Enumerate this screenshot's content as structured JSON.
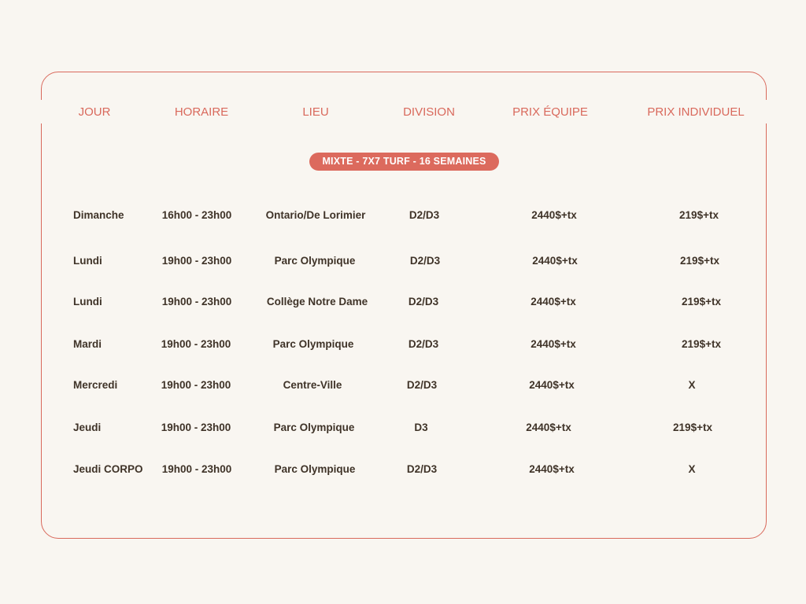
{
  "headers": [
    "JOUR",
    "HORAIRE",
    "LIEU",
    "DIVISION",
    "PRIX ÉQUIPE",
    "PRIX INDIVIDUEL"
  ],
  "league_label": "MIXTE - 7X7 TURF - 16 SEMAINES",
  "rows": [
    {
      "jour": "Dimanche",
      "horaire": "16h00 - 23h00",
      "lieu": "Ontario/De Lorimier",
      "division": "D2/D3",
      "prix_equipe": "2440$+tx",
      "prix_individuel": "219$+tx"
    },
    {
      "jour": "Lundi",
      "horaire": "19h00 - 23h00",
      "lieu": "Parc Olympique",
      "division": "D2/D3",
      "prix_equipe": "2440$+tx",
      "prix_individuel": "219$+tx"
    },
    {
      "jour": "Lundi",
      "horaire": "19h00 - 23h00",
      "lieu": "Collège Notre Dame",
      "division": "D2/D3",
      "prix_equipe": "2440$+tx",
      "prix_individuel": "219$+tx"
    },
    {
      "jour": "Mardi",
      "horaire": "19h00 - 23h00",
      "lieu": "Parc Olympique",
      "division": "D2/D3",
      "prix_equipe": "2440$+tx",
      "prix_individuel": "219$+tx"
    },
    {
      "jour": "Mercredi",
      "horaire": "19h00 - 23h00",
      "lieu": "Centre-Ville",
      "division": "D2/D3",
      "prix_equipe": "2440$+tx",
      "prix_individuel": "X"
    },
    {
      "jour": "Jeudi",
      "horaire": "19h00 - 23h00",
      "lieu": "Parc Olympique",
      "division": "D3",
      "prix_equipe": "2440$+tx",
      "prix_individuel": "219$+tx"
    },
    {
      "jour": "Jeudi CORPO",
      "horaire": "19h00 - 23h00",
      "lieu": "Parc Olympique",
      "division": "D2/D3",
      "prix_equipe": "2440$+tx",
      "prix_individuel": "X"
    }
  ],
  "colors": {
    "accent": "#d9695c",
    "text": "#3f3328",
    "background": "#f9f6f1"
  }
}
